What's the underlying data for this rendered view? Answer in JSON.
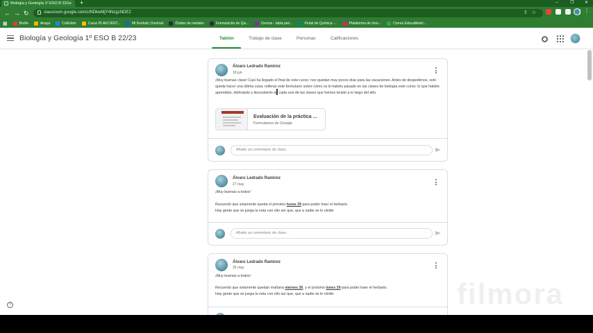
{
  "browser": {
    "tab_title": "Biología y Geología 1º ESO B 22/2",
    "url": "classroom.google.com/c/NDkwMjY4NzgzNDE2",
    "bookmarks": [
      {
        "label": "Bruño",
        "color": "#e53935"
      },
      {
        "label": "Anaya",
        "color": "#f4b400"
      },
      {
        "label": "CoRubric",
        "color": "#1e88e5"
      },
      {
        "label": "Curso PLAN DIGIT...",
        "color": "#fbbc04"
      },
      {
        "label": "Mi Kenhub | Kenhub",
        "color": "#1565c0"
      },
      {
        "label": "Óxidos de metales",
        "color": "#263238"
      },
      {
        "label": "Formulación de Qui...",
        "color": "#263238"
      },
      {
        "label": "Ciencia - tabla peri...",
        "color": "#8e24aa"
      },
      {
        "label": "Portal de Química -...",
        "color": "#00897b"
      },
      {
        "label": "Plataforma de Inno...",
        "color": "#e91e63"
      },
      {
        "label": "Correo EducaMadri...",
        "color": "#43a047"
      }
    ]
  },
  "header": {
    "class_name": "Biología y Geología 1º ESO B 22/23",
    "tabs": [
      {
        "label": "Tablón",
        "active": true
      },
      {
        "label": "Trabajo de clase",
        "active": false
      },
      {
        "label": "Personas",
        "active": false
      },
      {
        "label": "Calificaciones",
        "active": false
      }
    ]
  },
  "comment_placeholder": "Añade un comentario de clase...",
  "posts": [
    {
      "author": "Álvaro Ledrado Ramírez",
      "date": "18 jun",
      "text": "¡Muy buenas clase! Casi ha llegado el final de este curso; nos quedan muy pocos días para las vacaciones. Antes de despedirnos, solo queda hacer una última cosa: rellenar este formulario sobre cómo os lo habéis pasado en las clases de biología este curso: lo que habéis aprendido, disfrutado y descubierto en cada una de las clases que hemos tenido a lo largo del año.",
      "attachment": {
        "title": "Evaluación de la práctica ...",
        "subtitle": "Formularios de Google"
      }
    },
    {
      "author": "Álvaro Ledrado Ramírez",
      "date": "27 may",
      "greeting": "¡Muy buenas a todos!",
      "l1_pre": "Recuerdo que solamente queda el próximo ",
      "l1_bold": "lunes 29",
      "l1_post": " para poder traer el herbario.",
      "line2": "Hay gente que se juega la nota con ello así que, que a nadie se le olvide"
    },
    {
      "author": "Álvaro Ledrado Ramírez",
      "date": "25 may",
      "greeting": "¡Muy buenas a todos!",
      "l1_pre": "Recuerdo que solamente quedan mañana ",
      "l1_bold1": "viernes 26",
      "l1_mid": ", y el próximo ",
      "l1_bold2": "lunes 29",
      "l1_post": " para poder traer el herbario.",
      "line2": "Hay gente que se juega la nota con ello así que, que a nadie se le olvide"
    }
  ],
  "watermark": "filmora",
  "help_glyph": "?"
}
